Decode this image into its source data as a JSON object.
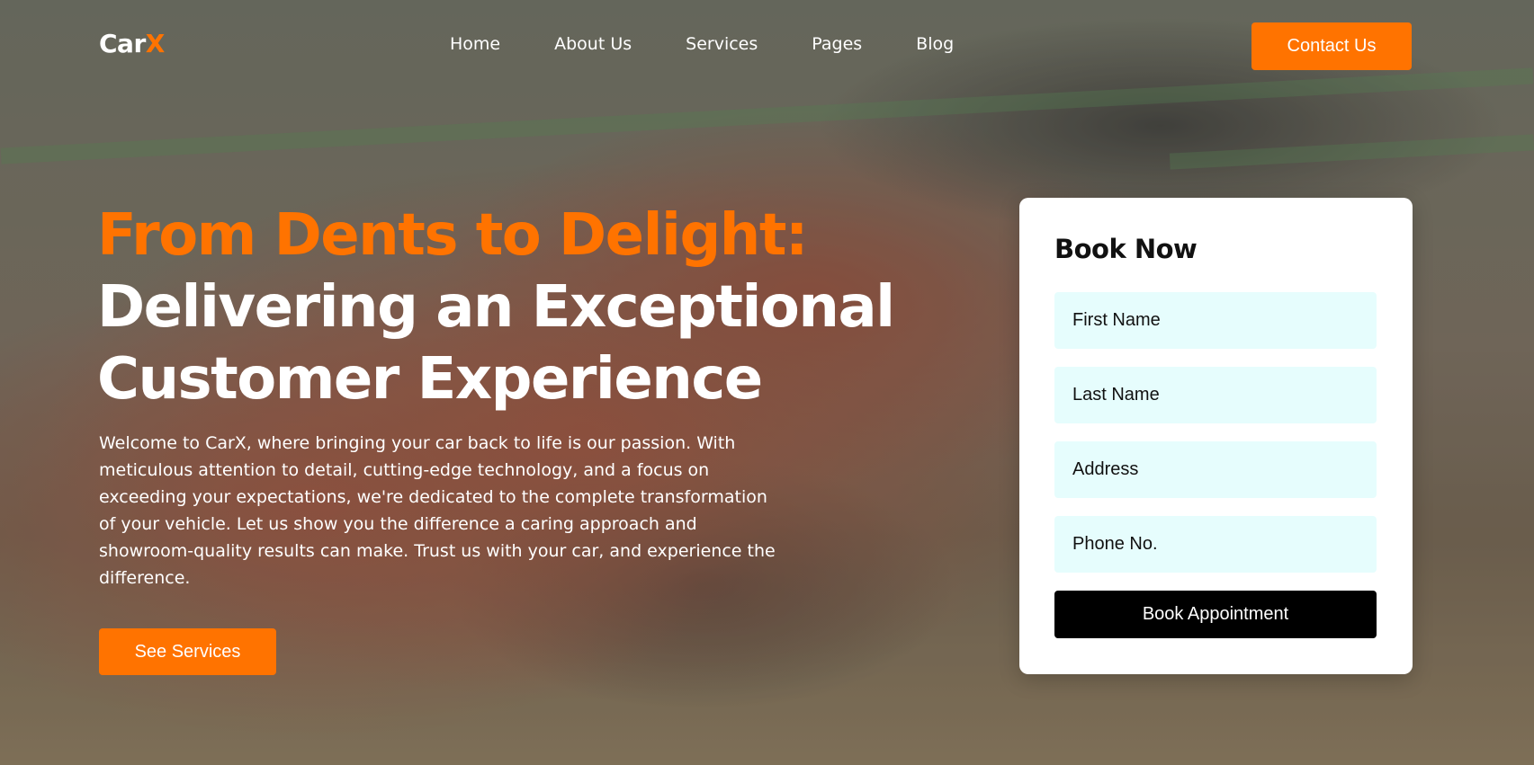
{
  "brand": {
    "name_main": "Car",
    "name_accent": "X"
  },
  "nav": {
    "items": [
      "Home",
      "About Us",
      "Services",
      "Pages",
      "Blog"
    ]
  },
  "header": {
    "contact_label": "Contact Us"
  },
  "hero": {
    "title_line1": "From Dents to Delight:",
    "title_line2": "Delivering an Exceptional",
    "title_line3": "Customer Experience",
    "description": "Welcome to CarX, where bringing your car back to life is our passion. With meticulous attention to detail, cutting-edge technology, and a focus on exceeding your expectations, we're dedicated to the complete transformation of your vehicle. Let us show you the difference a caring approach and showroom-quality results can make. Trust us with your car, and experience the difference.",
    "cta_label": "See Services"
  },
  "booking": {
    "title": "Book Now",
    "first_name_placeholder": "First Name",
    "last_name_placeholder": "Last Name",
    "address_placeholder": "Address",
    "phone_placeholder": "Phone No.",
    "submit_label": "Book Appointment"
  },
  "colors": {
    "accent": "#ff7300",
    "field_bg": "#e6fdfd",
    "button_dark": "#000000"
  }
}
